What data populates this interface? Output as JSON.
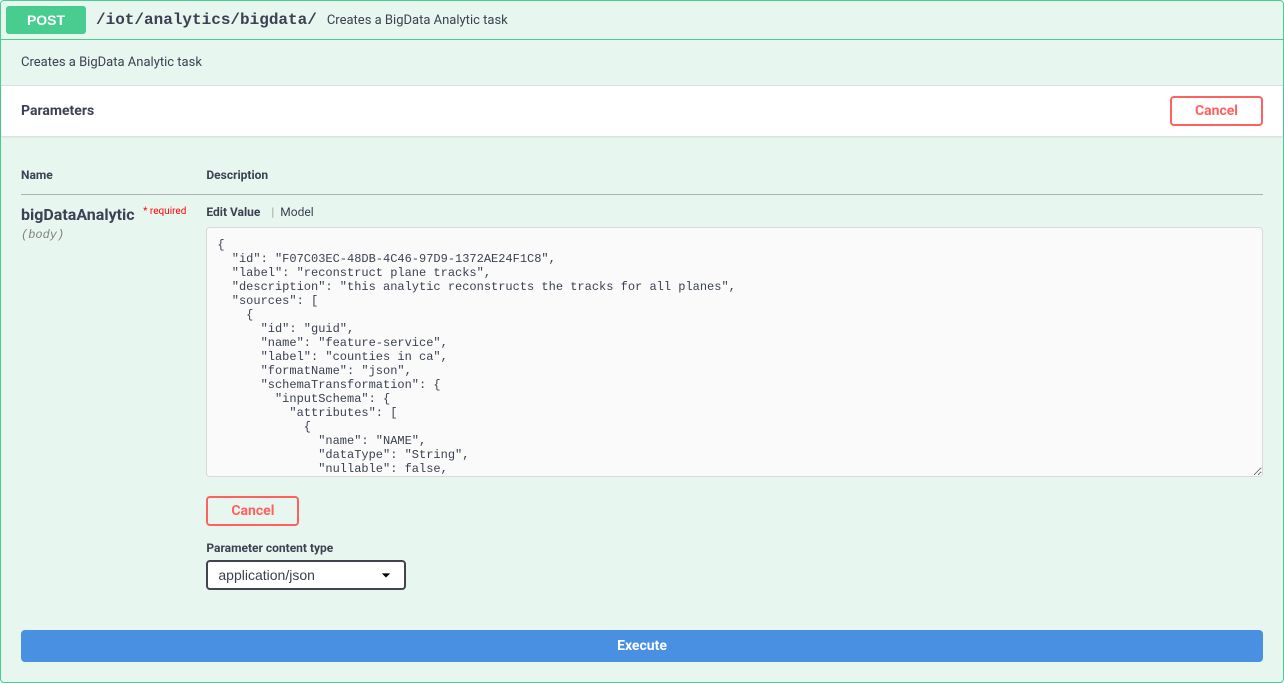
{
  "header": {
    "method": "POST",
    "path": "/iot/analytics/bigdata/",
    "summary": "Creates a BigData Analytic task"
  },
  "description": "Creates a BigData Analytic task",
  "parametersSection": {
    "title": "Parameters",
    "cancelLabel": "Cancel",
    "columns": {
      "name": "Name",
      "description": "Description"
    }
  },
  "param": {
    "name": "bigDataAnalytic",
    "requiredLabel": "* required",
    "in": "(body)",
    "tabs": {
      "editValue": "Edit Value",
      "model": "Model"
    },
    "bodyValue": "{\n  \"id\": \"F07C03EC-48DB-4C46-97D9-1372AE24F1C8\",\n  \"label\": \"reconstruct plane tracks\",\n  \"description\": \"this analytic reconstructs the tracks for all planes\",\n  \"sources\": [\n    {\n      \"id\": \"guid\",\n      \"name\": \"feature-service\",\n      \"label\": \"counties in ca\",\n      \"formatName\": \"json\",\n      \"schemaTransformation\": {\n        \"inputSchema\": {\n          \"attributes\": [\n            {\n              \"name\": \"NAME\",\n              \"dataType\": \"String\",\n              \"nullable\": false,\n              \"tags\": [\n                \"string\"\n              ]\n",
    "cancelLabel": "Cancel",
    "contentTypeLabel": "Parameter content type",
    "contentTypeValue": "application/json",
    "contentTypeOptions": [
      "application/json"
    ]
  },
  "executeLabel": "Execute"
}
